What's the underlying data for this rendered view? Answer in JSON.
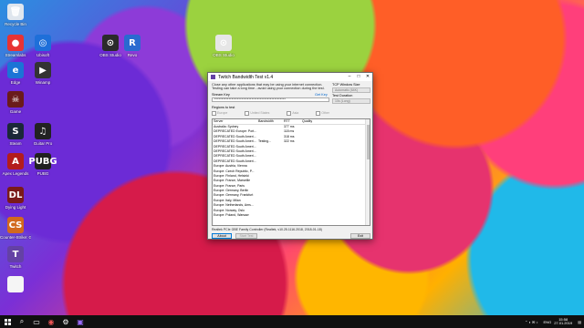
{
  "desktop_icons": [
    {
      "id": "recycle",
      "label": "Recycle Bin",
      "glyph": "🗑",
      "color": "#dfe6ee"
    },
    {
      "id": "redstone",
      "label": "Streamlabs",
      "glyph": "●",
      "color": "#e83333"
    },
    {
      "id": "edge",
      "label": "Edge",
      "glyph": "e",
      "color": "#1b74d6"
    },
    {
      "id": "game",
      "label": "Game",
      "glyph": "☠",
      "color": "#6a1b1b"
    },
    {
      "id": "steam",
      "label": "Steam",
      "glyph": "S",
      "color": "#1b2838"
    },
    {
      "id": "apex",
      "label": "Apex Legends",
      "glyph": "A",
      "color": "#b31c1c"
    },
    {
      "id": "dying",
      "label": "Dying Light",
      "glyph": "DL",
      "color": "#7a1a1a"
    },
    {
      "id": "csgo",
      "label": "Counter-Strike: Global Offensive",
      "glyph": "CS",
      "color": "#d2691e"
    },
    {
      "id": "twitch",
      "label": "Twitch",
      "glyph": "T",
      "color": "#6441a5"
    },
    {
      "id": "doc",
      "label": "",
      "glyph": "",
      "color": "#f5f5f5"
    },
    {
      "id": "obs1",
      "label": "OBS Studio",
      "glyph": "⊙",
      "color": "#2b2b2b"
    },
    {
      "id": "r",
      "label": "Revo",
      "glyph": "R",
      "color": "#2a6ad0"
    },
    {
      "id": "obs2",
      "label": "OBS Studio",
      "glyph": "⊙",
      "color": "#e6e6e6"
    },
    {
      "id": "pubg",
      "label": "PUBG",
      "glyph": "PUBG",
      "color": "#202020"
    },
    {
      "id": "winamp",
      "label": "Winamp",
      "glyph": "▶",
      "color": "#333333"
    },
    {
      "id": "guitar",
      "label": "Guitar Pro",
      "glyph": "♫",
      "color": "#222222"
    },
    {
      "id": "ubi",
      "label": "Ubisoft",
      "glyph": "◎",
      "color": "#1e6fd9"
    }
  ],
  "window": {
    "title": "Twitch Bandwidth Test v1.4",
    "info": "Close any other applications that may be using your internet connection. Testing can take a long time - avoid using your connection during the test.",
    "stream_key_label": "Stream Key",
    "get_key": "Get Key",
    "stream_key_value": "**************************************************",
    "regions_label": "Regions to test",
    "regions": [
      "Europe",
      "United States",
      "Asia",
      "Other"
    ],
    "right_panel": {
      "tcp_label": "TCP Window Size",
      "tcp_value": "Automatic (64K)",
      "duration_label": "Test Duration",
      "duration_value": "10s (Long)"
    },
    "columns": [
      "Server",
      "Bandwidth",
      "RTT",
      "Quality"
    ],
    "rows": [
      {
        "server": "Australia: Sydney",
        "bw": "",
        "rtt": "377 ms",
        "q": ""
      },
      {
        "server": "DEPRECATED Europe: Port...",
        "bw": "",
        "rtt": "118 ms",
        "q": ""
      },
      {
        "server": "DEPRECATED South Ameri...",
        "bw": "",
        "rtt": "318 ms",
        "q": ""
      },
      {
        "server": "DEPRECATED South Ameri...",
        "bw": "Testing...",
        "rtt": "322 ms",
        "q": ""
      },
      {
        "server": "DEPRECATED South Ameri...",
        "bw": "",
        "rtt": "",
        "q": ""
      },
      {
        "server": "DEPRECATED South Ameri...",
        "bw": "",
        "rtt": "",
        "q": ""
      },
      {
        "server": "DEPRECATED South Ameri...",
        "bw": "",
        "rtt": "",
        "q": ""
      },
      {
        "server": "DEPRECATED South Ameri...",
        "bw": "",
        "rtt": "",
        "q": ""
      },
      {
        "server": "Europe: Austria, Vienna",
        "bw": "",
        "rtt": "",
        "q": ""
      },
      {
        "server": "Europe: Czech Republic, P...",
        "bw": "",
        "rtt": "",
        "q": ""
      },
      {
        "server": "Europe: Finland, Helsinki",
        "bw": "",
        "rtt": "",
        "q": ""
      },
      {
        "server": "Europe: France, Marseille",
        "bw": "",
        "rtt": "",
        "q": ""
      },
      {
        "server": "Europe: France, Paris",
        "bw": "",
        "rtt": "",
        "q": ""
      },
      {
        "server": "Europe: Germany, Berlin",
        "bw": "",
        "rtt": "",
        "q": ""
      },
      {
        "server": "Europe: Germany, Frankfurt",
        "bw": "",
        "rtt": "",
        "q": ""
      },
      {
        "server": "Europe: Italy, Milan",
        "bw": "",
        "rtt": "",
        "q": ""
      },
      {
        "server": "Europe: Netherlands, Ams...",
        "bw": "",
        "rtt": "",
        "q": ""
      },
      {
        "server": "Europe: Norway, Oslo",
        "bw": "",
        "rtt": "",
        "q": ""
      },
      {
        "server": "Europe: Poland, Warsaw",
        "bw": "",
        "rtt": "",
        "q": ""
      }
    ],
    "adapter": "Realtek PCIe GBE Family Controller (Realtek, v10.25.1116.2018, 2018-01-18)",
    "about_label": "About",
    "start_label": "Start Test",
    "exit_label": "Exit"
  },
  "taskbar": {
    "apps": [
      "⊞",
      "🔍",
      "▭",
      "◉",
      "☗",
      "▣"
    ],
    "tray_lang": "ENG",
    "time": "15:58",
    "date": "27.01.2019"
  }
}
